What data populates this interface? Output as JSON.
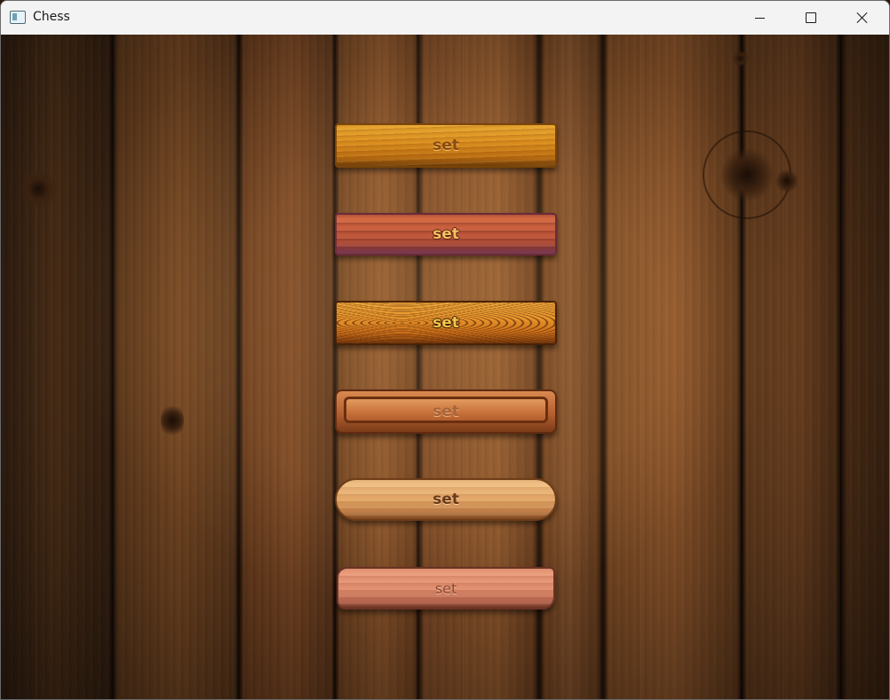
{
  "window": {
    "title": "Chess",
    "controls": {
      "minimize": "minimize-icon",
      "maximize": "maximize-icon",
      "close": "close-icon"
    }
  },
  "menu": {
    "buttons": [
      {
        "label": "set",
        "style": "golden-plank"
      },
      {
        "label": "set",
        "style": "red-plank"
      },
      {
        "label": "set",
        "style": "grain-plank"
      },
      {
        "label": "set",
        "style": "framed-plank"
      },
      {
        "label": "set",
        "style": "rounded-plank"
      },
      {
        "label": "set",
        "style": "cracked-plank"
      }
    ]
  },
  "colors": {
    "background_wood": "#5a3419",
    "titlebar": "#f3f3f3"
  }
}
